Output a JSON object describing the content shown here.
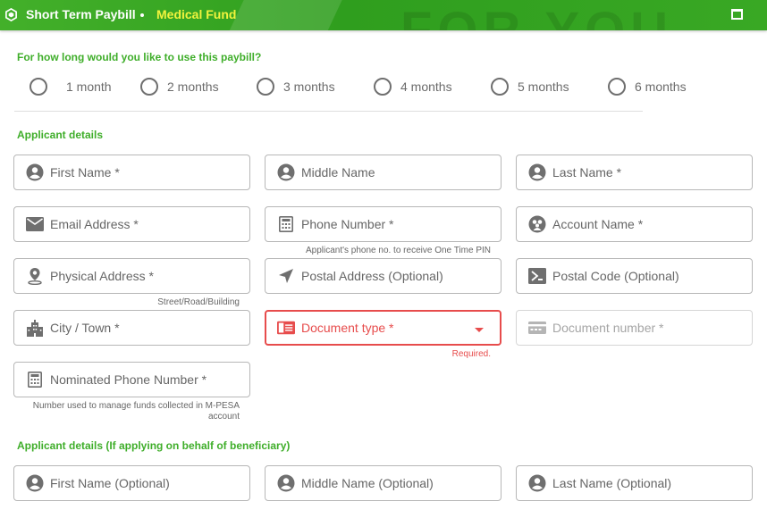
{
  "header": {
    "app_title": "Short Term Paybill",
    "sub_title": "Medical Fund",
    "background_text": "FOR YOU",
    "colors": {
      "bar": "#3aa823",
      "subtitle": "#f1f33d"
    }
  },
  "duration": {
    "question": "For how long would you like to use this paybill?",
    "options": [
      "1 month",
      "2 months",
      "3 months",
      "4 months",
      "5 months",
      "6 months"
    ]
  },
  "applicant": {
    "heading": "Applicant details",
    "first_name": "First Name *",
    "middle_name": "Middle Name",
    "last_name": "Last Name *",
    "email": "Email Address *",
    "phone": "Phone Number *",
    "phone_hint": "Applicant's phone no. to receive One Time PIN",
    "account_name": "Account Name *",
    "physical_address": "Physical Address *",
    "physical_hint": "Street/Road/Building",
    "postal_address": "Postal Address (Optional)",
    "postal_code": "Postal Code (Optional)",
    "city": "City / Town *",
    "document_type": "Document type *",
    "document_error": "Required.",
    "document_number": "Document number *",
    "nominated_phone": "Nominated Phone Number *",
    "nominated_hint": "Number used to manage funds collected in M-PESA account"
  },
  "beneficiary": {
    "heading": "Applicant details (If applying on behalf of beneficiary)",
    "first_name": "First Name (Optional)",
    "middle_name": "Middle Name (Optional)",
    "last_name": "Last Name (Optional)"
  },
  "colors": {
    "accent": "#3fae2a",
    "error": "#e74c4c",
    "border": "#b7b7b7"
  }
}
